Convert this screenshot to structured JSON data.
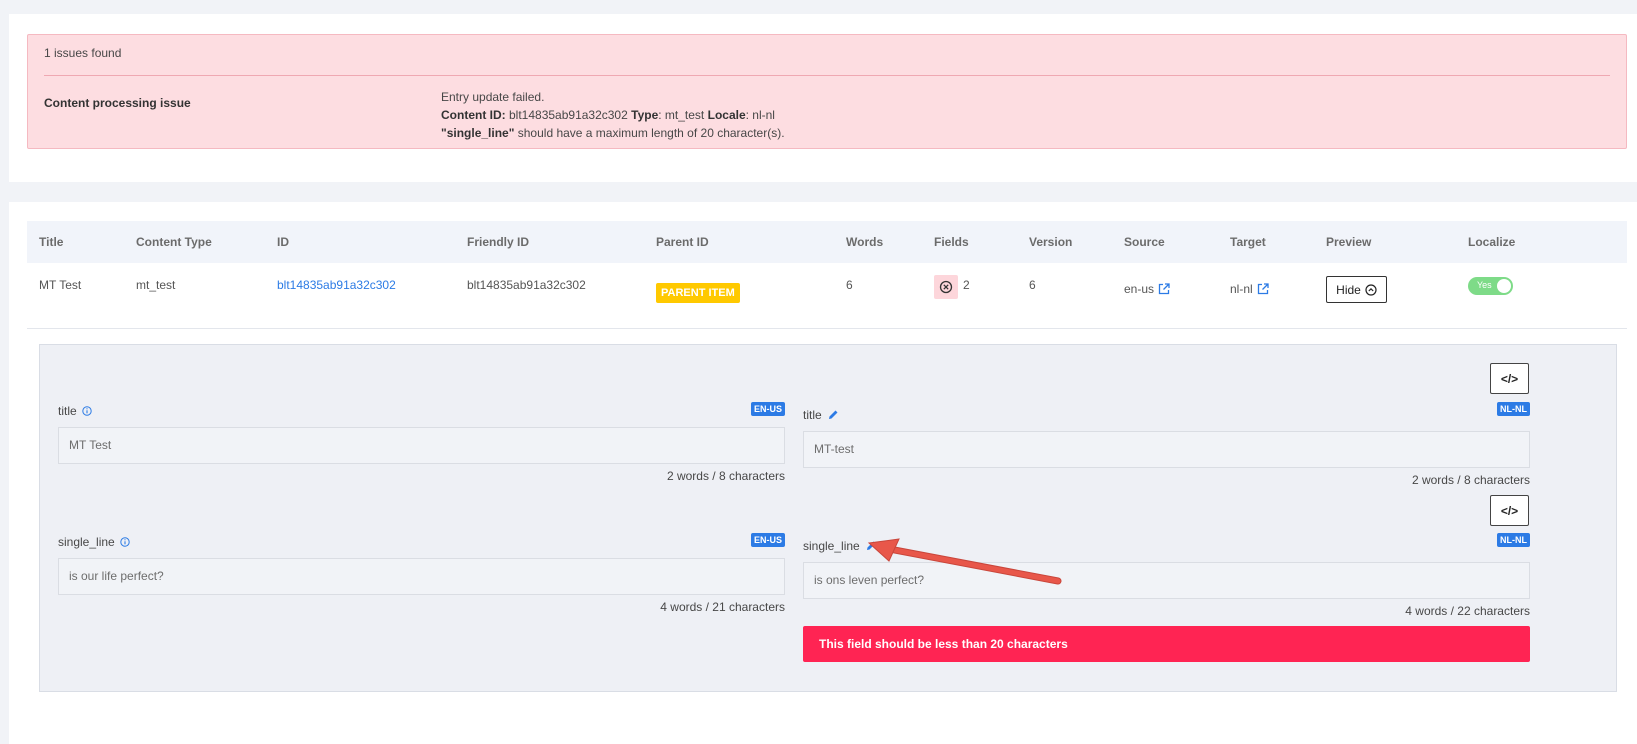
{
  "issues": {
    "count_text": "1 issues found",
    "label": "Content processing issue",
    "line1": "Entry update failed.",
    "content_id_label": "Content ID:",
    "content_id": "blt14835ab91a32c302",
    "type_label": "Type",
    "type_value": ": mt_test",
    "locale_label": "Locale",
    "locale_value": ": nl-nl",
    "field_name": "\"single_line\"",
    "field_message": "should have a maximum length of 20 character(s)."
  },
  "table": {
    "headers": [
      "Title",
      "Content Type",
      "ID",
      "Friendly ID",
      "Parent ID",
      "Words",
      "Fields",
      "Version",
      "Source",
      "Target",
      "Preview",
      "Localize"
    ],
    "row": {
      "title": "MT Test",
      "content_type": "mt_test",
      "id": "blt14835ab91a32c302",
      "friendly_id": "blt14835ab91a32c302",
      "parent_badge": "PARENT ITEM",
      "words": "6",
      "fields": "2",
      "version": "6",
      "source": "en-us",
      "target": "nl-nl",
      "preview_button": "Hide",
      "localize_toggle": "Yes"
    }
  },
  "preview": {
    "code_button": "</>",
    "fields": [
      {
        "source_label": "title",
        "source_locale": "EN-US",
        "source_value": "MT Test",
        "source_count": "2 words / 8 characters",
        "target_label": "title",
        "target_locale": "NL-NL",
        "target_value": "MT-test",
        "target_count": "2 words / 8 characters"
      },
      {
        "source_label": "single_line",
        "source_locale": "EN-US",
        "source_value": "is our life perfect?",
        "source_count": "4 words / 21 characters",
        "target_label": "single_line",
        "target_locale": "NL-NL",
        "target_value": "is ons leven perfect?",
        "target_count": "4 words / 22 characters",
        "error": "This field should be less than 20 characters"
      }
    ]
  },
  "colors": {
    "accent": "#2c7be5",
    "error": "#ff2453",
    "issue_bg": "#fddde1",
    "parent_badge": "#ffc900",
    "toggle_on": "#7edb88",
    "arrow": "#e8574a"
  },
  "icons": [
    "info-icon",
    "pencil-icon",
    "external-link-icon",
    "error-circle-icon",
    "chevron-up-circle-icon",
    "code-icon",
    "annotation-arrow"
  ]
}
